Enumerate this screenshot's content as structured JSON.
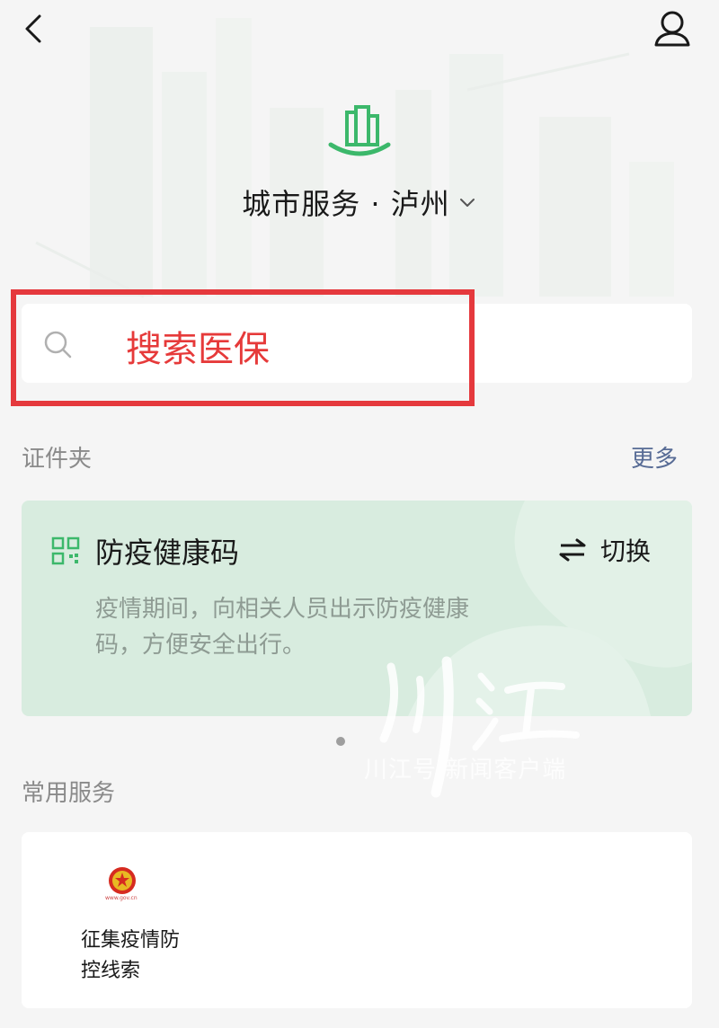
{
  "header": {
    "city_title": "城市服务 · 泸州"
  },
  "search": {
    "text": "搜索医保"
  },
  "credentials": {
    "section_label": "证件夹",
    "more_label": "更多",
    "card": {
      "title": "防疫健康码",
      "switch_label": "切换",
      "description": "疫情期间，向相关人员出示防疫健康码，方便安全出行。"
    }
  },
  "services": {
    "section_label": "常用服务",
    "items": [
      {
        "icon": "national-emblem-icon",
        "emblem_url": "www.gov.cn",
        "label": "征集疫情防控线索"
      }
    ]
  },
  "watermark": {
    "text": "川江",
    "subtitle": "川江号 新闻客户端"
  },
  "colors": {
    "accent_green": "#3cb86b",
    "highlight_red": "#e5393d",
    "search_text_red": "#e63a3a",
    "link_blue": "#576b95",
    "card_green": "#d8ecdf"
  },
  "icons": [
    "back-arrow-icon",
    "user-icon",
    "city-building-icon",
    "chevron-down-icon",
    "search-icon",
    "qr-code-icon",
    "switch-arrows-icon",
    "national-emblem-icon"
  ]
}
